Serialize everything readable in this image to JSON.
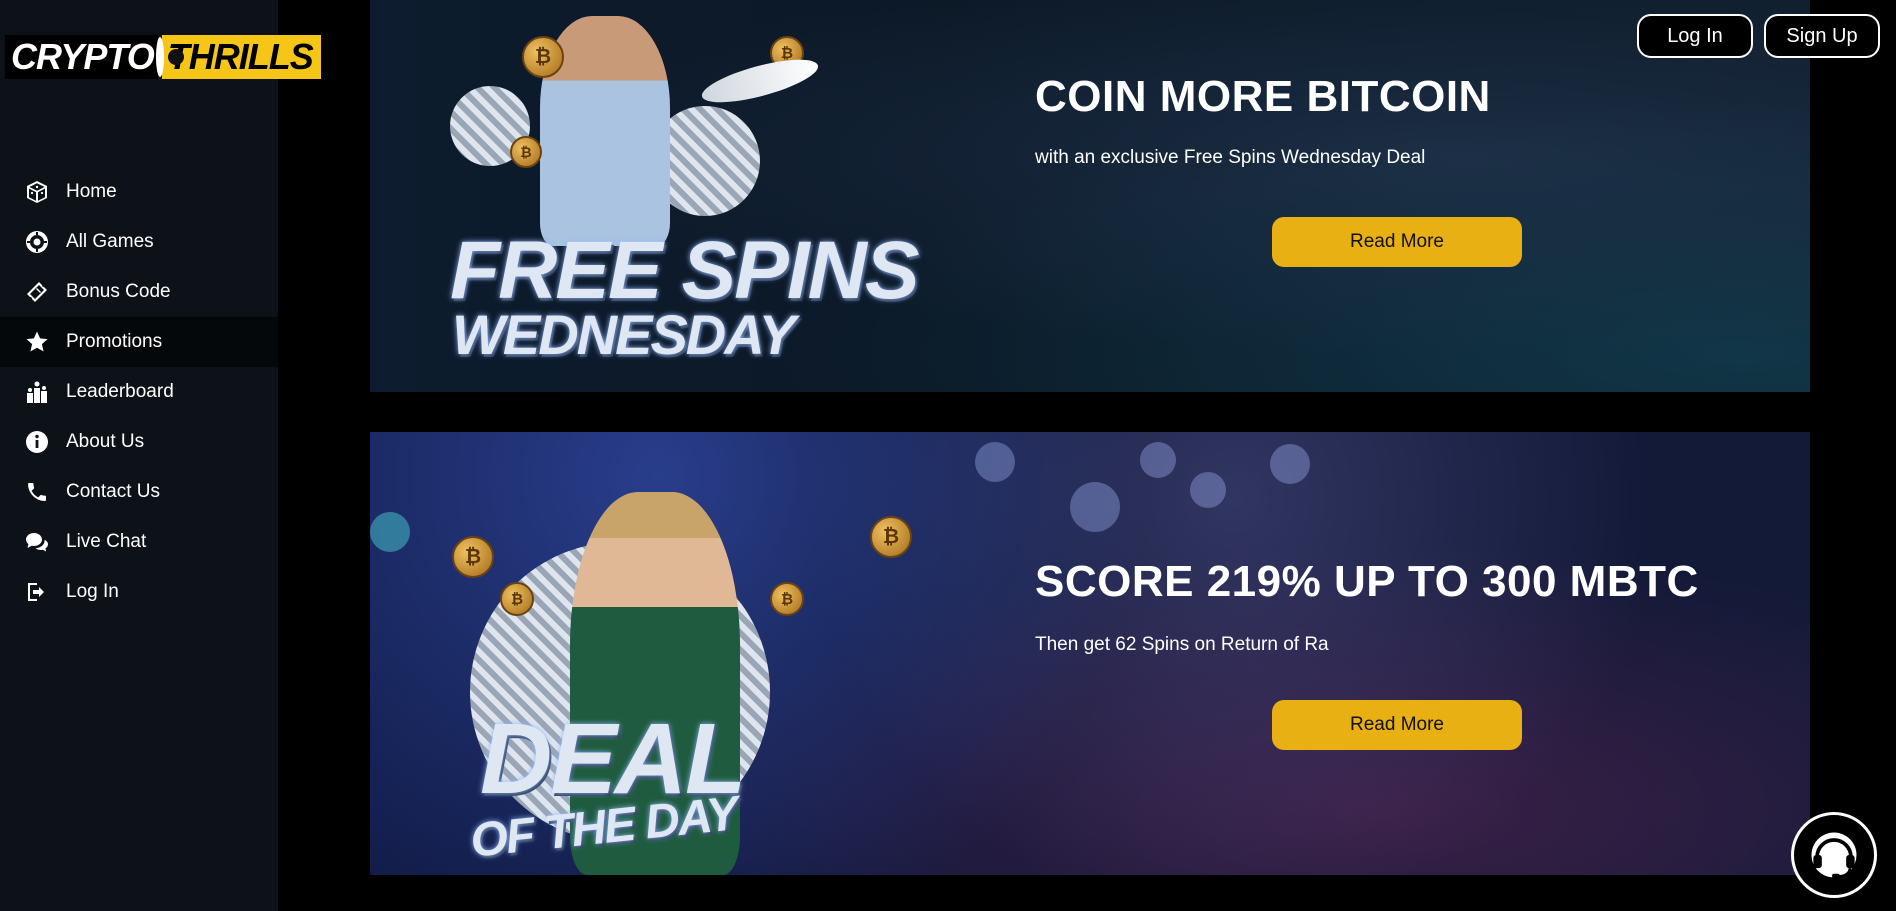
{
  "brand": {
    "logo_left": "CRYPTO",
    "logo_right": "THRILLS",
    "accent_color": "#f5c518"
  },
  "sidebar": {
    "items": [
      {
        "label": "Home",
        "icon": "dice-icon"
      },
      {
        "label": "All Games",
        "icon": "poker-chip-icon"
      },
      {
        "label": "Bonus Code",
        "icon": "ticket-icon"
      },
      {
        "label": "Promotions",
        "icon": "star-icon",
        "active": true
      },
      {
        "label": "Leaderboard",
        "icon": "trophy-icon"
      },
      {
        "label": "About Us",
        "icon": "info-icon"
      },
      {
        "label": "Contact Us",
        "icon": "phone-icon"
      },
      {
        "label": "Live Chat",
        "icon": "chat-icon"
      },
      {
        "label": "Log In",
        "icon": "login-icon"
      }
    ]
  },
  "header": {
    "login_label": "Log In",
    "signup_label": "Sign Up"
  },
  "promos": [
    {
      "art_line1": "FREE SPINS",
      "art_line2": "WEDNESDAY",
      "title": "COIN MORE BITCOIN",
      "subtitle": "with an exclusive Free Spins Wednesday Deal",
      "button_label": "Read More"
    },
    {
      "art_line1": "DEAL",
      "art_line2": "OF THE DAY",
      "title": "SCORE 219% UP TO 300 MBTC",
      "subtitle": "Then get 62 Spins on Return of Ra",
      "button_label": "Read More"
    }
  ],
  "coin_symbol": "₿",
  "colors": {
    "sidebar_bg": "#0d1218",
    "button_yellow": "#e8b012"
  }
}
